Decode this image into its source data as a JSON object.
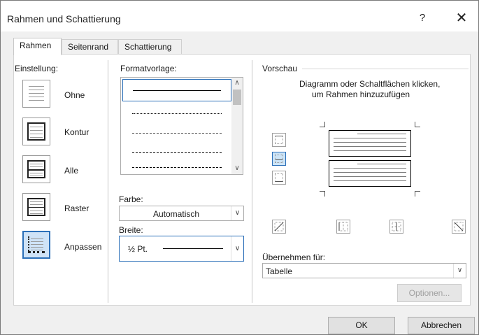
{
  "window": {
    "title": "Rahmen und Schattierung",
    "help_label": "?",
    "close_label": "✕"
  },
  "tabs": [
    {
      "label": "Rahmen",
      "active": true
    },
    {
      "label": "Seitenrand",
      "active": false
    },
    {
      "label": "Schattierung",
      "active": false
    }
  ],
  "settings": {
    "heading": "Einstellung:",
    "items": [
      {
        "label": "Ohne",
        "icon": "border-none-icon"
      },
      {
        "label": "Kontur",
        "icon": "border-box-icon"
      },
      {
        "label": "Alle",
        "icon": "border-all-icon"
      },
      {
        "label": "Raster",
        "icon": "border-grid-icon"
      },
      {
        "label": "Anpassen",
        "icon": "border-custom-icon",
        "selected": true
      }
    ]
  },
  "style": {
    "heading": "Formatvorlage:",
    "items": [
      "solid",
      "dotted",
      "dashed-fine",
      "dashed",
      "dash-dot"
    ],
    "selected_index": 0
  },
  "color": {
    "label": "Farbe:",
    "value": "Automatisch"
  },
  "width": {
    "label": "Breite:",
    "value": "½ Pt."
  },
  "preview": {
    "heading": "Vorschau",
    "hint_line1": "Diagramm oder Schaltflächen klicken,",
    "hint_line2": "um Rahmen hinzuzufügen"
  },
  "apply_to": {
    "label": "Übernehmen für:",
    "value": "Tabelle"
  },
  "buttons": {
    "options": "Optionen...",
    "ok": "OK",
    "cancel": "Abbrechen"
  },
  "colors": {
    "accent": "#2b6fb8",
    "dialog_bg": "#f0f0f0",
    "panel_bg": "#ffffff"
  }
}
